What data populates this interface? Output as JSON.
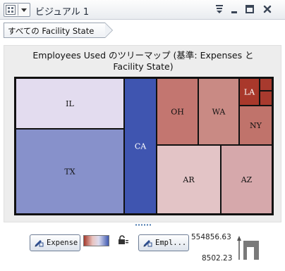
{
  "window": {
    "title": "ビジュアル 1",
    "menu_icon": "grid-icon",
    "controls": [
      "filter-menu-icon",
      "minimize-icon",
      "maximize-icon",
      "close-icon"
    ]
  },
  "breadcrumb": {
    "label": "すべての Facility State"
  },
  "colors": {
    "accent_dark": "#3f55a6",
    "low_red": "#a5372b",
    "neutral": "#e8e0ee",
    "high_blue": "#3f55b0",
    "border": "#111111",
    "panel_bg": "#ededed"
  },
  "chart_data": {
    "type": "treemap",
    "title_line1": "Employees Used のツリーマップ (基準: Expenses と",
    "title_line2": "Facility State)",
    "size_role": "Expenses",
    "color_role": "Employees Used",
    "color_range": {
      "max": "554856.63",
      "min": "8502.23"
    },
    "tiles": [
      {
        "label": "IL",
        "color": "#e3dcef"
      },
      {
        "label": "TX",
        "color": "#8791cb"
      },
      {
        "label": "CA",
        "color": "#3f55b0"
      },
      {
        "label": "OH",
        "color": "#c37670"
      },
      {
        "label": "WA",
        "color": "#c98a84"
      },
      {
        "label": "LA",
        "color": "#a9382b"
      },
      {
        "label": "",
        "color": "#a83a2e"
      },
      {
        "label": "",
        "color": "#a83a2e"
      },
      {
        "label": "NY",
        "color": "#c0736b"
      },
      {
        "label": "AR",
        "color": "#e3c4c6"
      },
      {
        "label": "AZ",
        "color": "#d6a8ab"
      }
    ]
  },
  "bottom_controls": {
    "expense_button": "Expense",
    "empl_button": "Empl...",
    "max_value": "554856.63",
    "min_value": "8502.23"
  },
  "icons": {
    "role_button_icon": "pencil-ruler-icon",
    "link_icon": "lock-link-icon",
    "size_legend_icon": "size-legend-icon"
  }
}
